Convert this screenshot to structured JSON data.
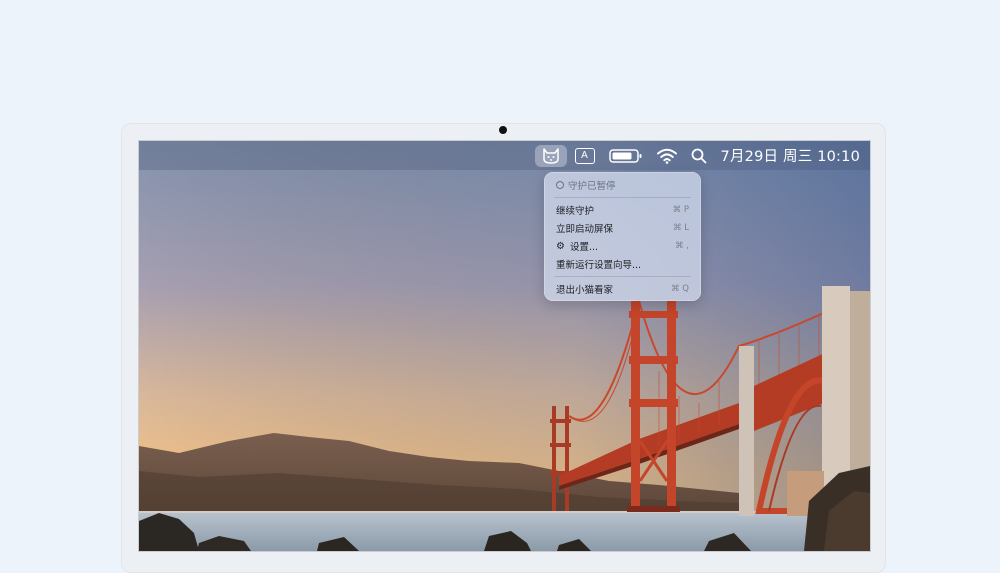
{
  "menubar": {
    "input_source": "A",
    "clock": "7月29日 周三 10:10"
  },
  "menu": {
    "status": "守护已暂停",
    "items": [
      {
        "label": "继续守护",
        "shortcut": "⌘ P"
      },
      {
        "label": "立即启动屏保",
        "shortcut": "⌘ L"
      },
      {
        "label": "设置...",
        "shortcut": "⌘ ,"
      },
      {
        "label": "重新运行设置向导...",
        "shortcut": ""
      },
      {
        "label": "退出小猫看家",
        "shortcut": "⌘ Q"
      }
    ]
  },
  "colors": {
    "page_background": "#edf3fb",
    "bridge": "#c8442a",
    "menu_background": "#d6def0"
  },
  "icons": [
    "cat-icon",
    "battery-icon",
    "wifi-icon",
    "search-icon",
    "gear-icon"
  ]
}
